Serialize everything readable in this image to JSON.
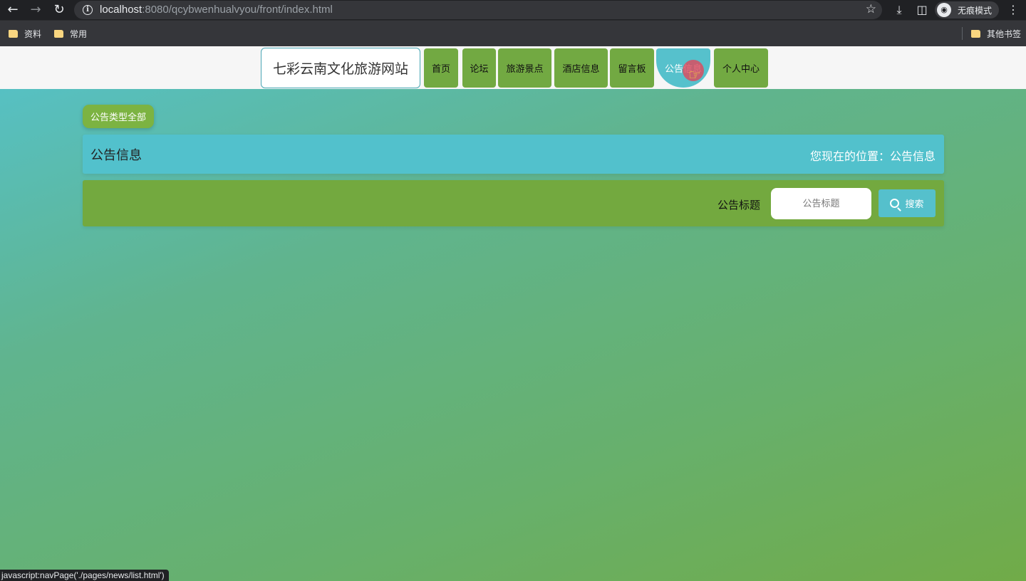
{
  "browser": {
    "url_host": "localhost",
    "url_rest": ":8080/qcybwenhualvyou/front/index.html",
    "incognito_label": "无痕模式",
    "bookmarks": [
      "资料",
      "常用"
    ],
    "other_bookmarks": "其他书签",
    "status_tip": "javascript:navPage('./pages/news/list.html')"
  },
  "nav": {
    "site_title": "七彩云南文化旅游网站",
    "items": [
      {
        "label": "首页"
      },
      {
        "label": "论坛"
      },
      {
        "label": "旅游景点"
      },
      {
        "label": "酒店信息"
      },
      {
        "label": "留言板"
      },
      {
        "label": "公告信息",
        "active": true
      },
      {
        "label": "个人中心"
      }
    ]
  },
  "main": {
    "category_button": "公告类型全部",
    "page_title": "公告信息",
    "location": "您现在的位置：公告信息",
    "search_label": "公告标题",
    "search_placeholder": "公告标题",
    "search_button": "搜索"
  },
  "colors": {
    "nav_green": "#72a942",
    "accent_teal": "#52c1cc",
    "panel_green": "#73a93f"
  }
}
